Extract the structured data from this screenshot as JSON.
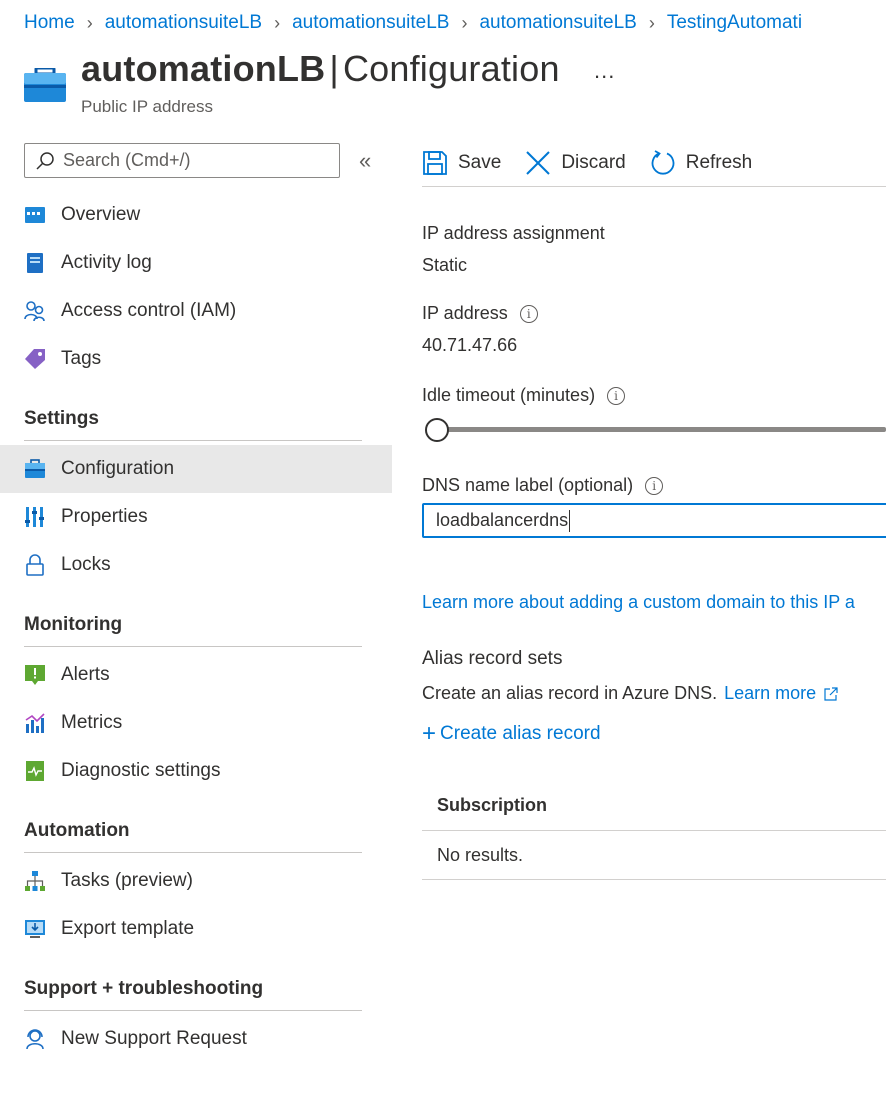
{
  "breadcrumb": [
    "Home",
    "automationsuiteLB",
    "automationsuiteLB",
    "automationsuiteLB",
    "TestingAutomati"
  ],
  "header": {
    "resource_name": "automationLB",
    "separator": "|",
    "blade": "Configuration",
    "more": "...",
    "subtitle": "Public IP address"
  },
  "sidebar": {
    "search_placeholder": "Search (Cmd+/)",
    "collapse": "«",
    "items": [
      {
        "label": "Overview",
        "icon": "overview-icon"
      },
      {
        "label": "Activity log",
        "icon": "activity-log-icon"
      },
      {
        "label": "Access control (IAM)",
        "icon": "iam-icon"
      },
      {
        "label": "Tags",
        "icon": "tag-icon"
      }
    ],
    "sections": [
      {
        "title": "Settings",
        "items": [
          {
            "label": "Configuration",
            "icon": "configuration-icon",
            "active": true
          },
          {
            "label": "Properties",
            "icon": "properties-icon"
          },
          {
            "label": "Locks",
            "icon": "lock-icon"
          }
        ]
      },
      {
        "title": "Monitoring",
        "items": [
          {
            "label": "Alerts",
            "icon": "alert-icon"
          },
          {
            "label": "Metrics",
            "icon": "metrics-icon"
          },
          {
            "label": "Diagnostic settings",
            "icon": "diagnostic-icon"
          }
        ]
      },
      {
        "title": "Automation",
        "items": [
          {
            "label": "Tasks (preview)",
            "icon": "tasks-icon"
          },
          {
            "label": "Export template",
            "icon": "export-template-icon"
          }
        ]
      },
      {
        "title": "Support + troubleshooting",
        "items": [
          {
            "label": "New Support Request",
            "icon": "support-icon"
          }
        ]
      }
    ]
  },
  "toolbar": {
    "save": "Save",
    "discard": "Discard",
    "refresh": "Refresh"
  },
  "form": {
    "assignment_label": "IP address assignment",
    "assignment_value": "Static",
    "ip_label": "IP address",
    "ip_value": "40.71.47.66",
    "idle_label": "Idle timeout (minutes)",
    "idle_slider_fraction": 0.0,
    "dns_label": "DNS name label (optional)",
    "dns_value": "loadbalancerdns",
    "info_glyph": "i"
  },
  "links": {
    "custom_domain": "Learn more about adding a custom domain to this IP a"
  },
  "alias": {
    "heading": "Alias record sets",
    "description": "Create an alias record in Azure DNS.",
    "learn_more": "Learn more",
    "create": "Create alias record",
    "create_plus": "+"
  },
  "grid": {
    "columns": [
      "Subscription"
    ],
    "empty_text": "No results."
  },
  "colors": {
    "accent": "#0078d4",
    "active_bg": "#e8e8e8",
    "text": "#323130"
  }
}
